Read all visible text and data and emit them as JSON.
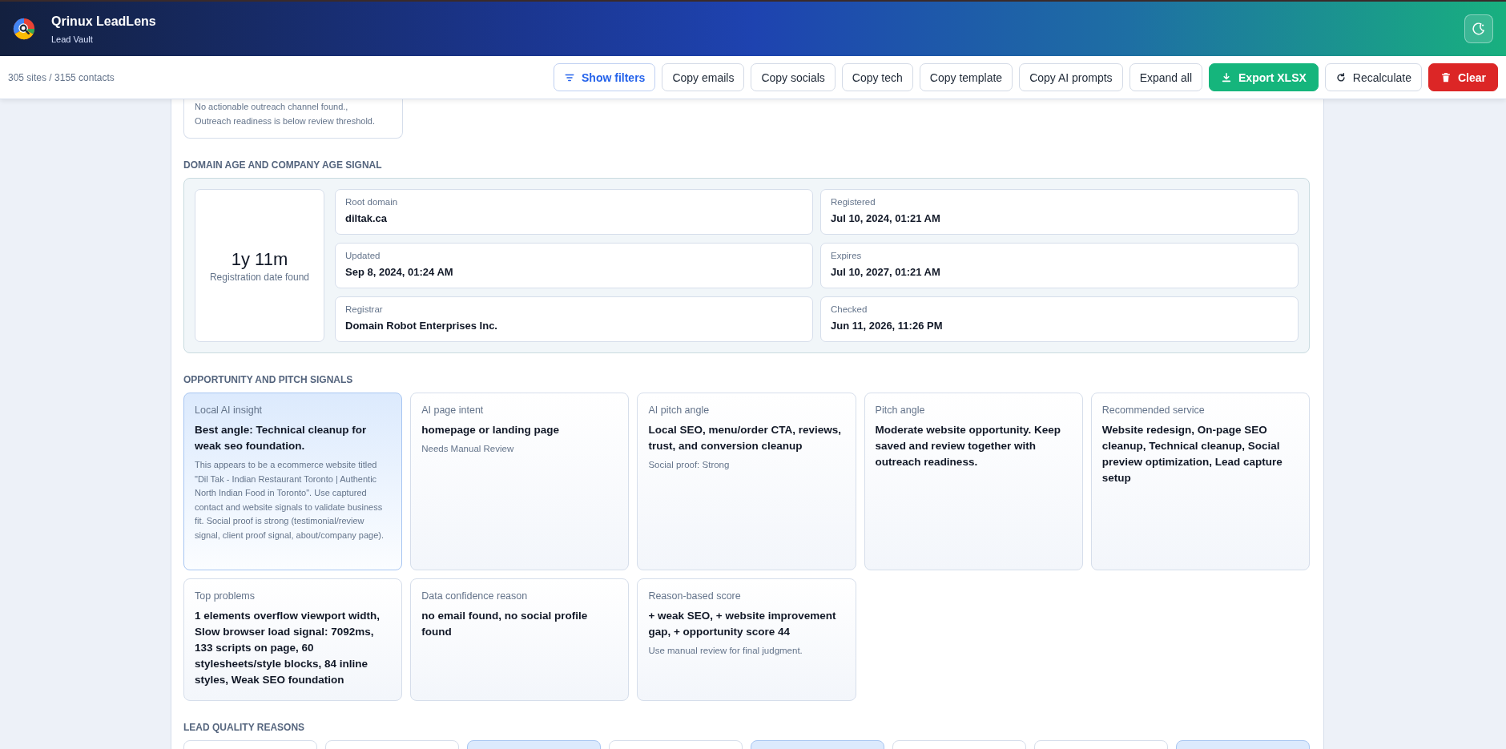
{
  "app": {
    "title": "Qrinux LeadLens",
    "subtitle": "Lead Vault"
  },
  "toolbar": {
    "summary": "305 sites / 3155 contacts",
    "buttons": [
      {
        "label": "Show filters",
        "kind": "filter"
      },
      {
        "label": "Copy emails",
        "kind": "default"
      },
      {
        "label": "Copy socials",
        "kind": "default"
      },
      {
        "label": "Copy tech",
        "kind": "default"
      },
      {
        "label": "Copy template",
        "kind": "default"
      },
      {
        "label": "Copy AI prompts",
        "kind": "default"
      },
      {
        "label": "Expand all",
        "kind": "default"
      },
      {
        "label": "Export XLSX",
        "kind": "export"
      },
      {
        "label": "Recalculate",
        "kind": "recalc"
      },
      {
        "label": "Clear",
        "kind": "clear"
      }
    ]
  },
  "outreach_note": {
    "lines": [
      "No actionable outreach channel found.,",
      "Outreach readiness is below review threshold."
    ]
  },
  "domain_section": {
    "title": "DOMAIN AGE AND COMPANY AGE SIGNAL",
    "age": "1y 11m",
    "age_note": "Registration date found",
    "fields": [
      {
        "label": "Root domain",
        "value": "diltak.ca"
      },
      {
        "label": "Registered",
        "value": "Jul 10, 2024, 01:21 AM"
      },
      {
        "label": "Updated",
        "value": "Sep 8, 2024, 01:24 AM"
      },
      {
        "label": "Expires",
        "value": "Jul 10, 2027, 01:21 AM"
      },
      {
        "label": "Registrar",
        "value": "Domain Robot Enterprises Inc."
      },
      {
        "label": "Checked",
        "value": "Jun 11, 2026, 11:26 PM"
      }
    ]
  },
  "pitch_section": {
    "title": "OPPORTUNITY AND PITCH SIGNALS",
    "cards": [
      {
        "label": "Local AI insight",
        "value": "Best angle: Technical cleanup for weak seo foundation.",
        "note": "This appears to be a ecommerce website titled \"Dil Tak - Indian Restaurant Toronto | Authentic North Indian Food in Toronto\". Use captured contact and website signals to validate business fit. Social proof is strong (testimonial/review signal, client proof signal, about/company page).",
        "highlighted": true
      },
      {
        "label": "AI page intent",
        "value": "homepage or landing page",
        "note": "Needs Manual Review",
        "highlighted": false
      },
      {
        "label": "AI pitch angle",
        "value": "Local SEO, menu/order CTA, reviews, trust, and conversion cleanup",
        "note": "Social proof: Strong",
        "highlighted": false
      },
      {
        "label": "Pitch angle",
        "value": "Moderate website opportunity. Keep saved and review together with outreach readiness.",
        "highlighted": false
      },
      {
        "label": "Recommended service",
        "value": "Website redesign, On-page SEO cleanup, Technical cleanup, Social preview optimization, Lead capture setup",
        "highlighted": false
      },
      {
        "label": "Top problems",
        "value": "1 elements overflow viewport width, Slow browser load signal: 7092ms, 133 scripts on page, 60 stylesheets/style blocks, 84 inline styles, Weak SEO foundation",
        "highlighted": false
      },
      {
        "label": "Data confidence reason",
        "value": "no email found, no social profile found",
        "highlighted": false
      },
      {
        "label": "Reason-based score",
        "value": "+ weak SEO, + website improvement gap, + opportunity score 44",
        "note": "Use manual review for final judgment.",
        "highlighted": false
      }
    ]
  },
  "quality_section": {
    "title": "LEAD QUALITY REASONS",
    "cards": [
      {
        "highlighted": false
      },
      {
        "highlighted": false
      },
      {
        "highlighted": true
      },
      {
        "highlighted": false
      },
      {
        "highlighted": true
      },
      {
        "highlighted": false
      },
      {
        "highlighted": false
      },
      {
        "highlighted": true
      }
    ]
  }
}
